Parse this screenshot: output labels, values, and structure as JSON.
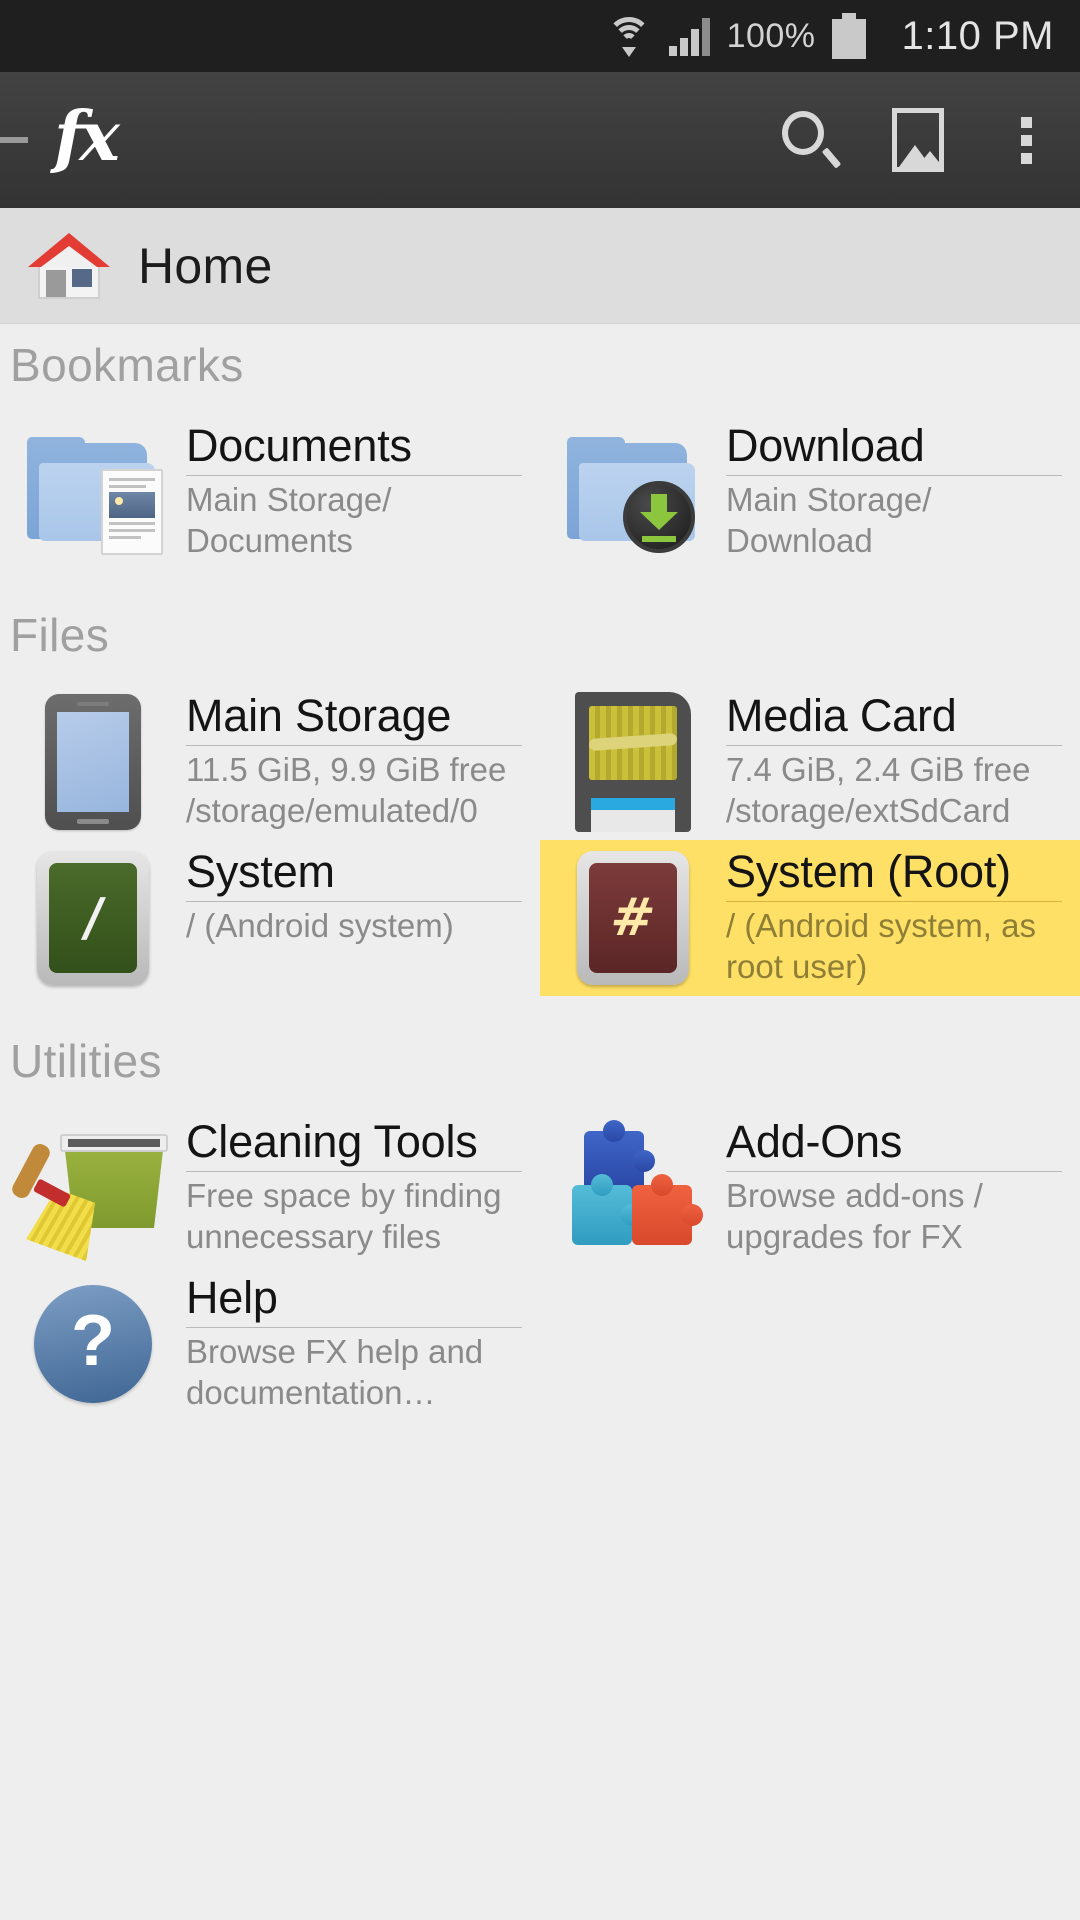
{
  "statusbar": {
    "wifi_icon": "wifi-icon",
    "signal_icon": "signal-bars-icon",
    "battery_percent": "100%",
    "battery_icon": "battery-full-icon",
    "time": "1:10 PM"
  },
  "appbar": {
    "drawer_indicator": "drawer-dash-icon",
    "logo": "fx",
    "search_icon": "search-icon",
    "gallery_icon": "gallery-icon",
    "overflow_icon": "overflow-menu-icon"
  },
  "breadcrumb": {
    "home_icon": "home-icon",
    "label": "Home"
  },
  "sections": [
    {
      "title": "Bookmarks",
      "items": [
        {
          "icon": "folder-documents-icon",
          "title": "Documents",
          "sub": "Main Storage/ Documents",
          "highlighted": false
        },
        {
          "icon": "folder-download-icon",
          "title": "Download",
          "sub": "Main Storage/ Download",
          "highlighted": false
        }
      ]
    },
    {
      "title": "Files",
      "items": [
        {
          "icon": "phone-icon",
          "title": "Main Storage",
          "sub": "11.5 GiB, 9.9 GiB free /storage/emulated/0",
          "highlighted": false
        },
        {
          "icon": "sd-card-icon",
          "title": "Media Card",
          "sub": "7.4 GiB, 2.4 GiB free /storage/extSdCard",
          "highlighted": false
        },
        {
          "icon": "terminal-green-icon",
          "title": "System",
          "sub": "/ (Android system)",
          "highlighted": false
        },
        {
          "icon": "terminal-root-icon",
          "title": "System (Root)",
          "sub": "/ (Android system, as root user)",
          "highlighted": true
        }
      ]
    },
    {
      "title": "Utilities",
      "items": [
        {
          "icon": "cleaning-tools-icon",
          "title": "Cleaning Tools",
          "sub": "Free space by finding unnecessary files",
          "highlighted": false
        },
        {
          "icon": "puzzle-addons-icon",
          "title": "Add-Ons",
          "sub": "Browse add-ons / upgrades for FX",
          "highlighted": false
        },
        {
          "icon": "help-icon",
          "title": "Help",
          "sub": "Browse FX help and documentation…",
          "highlighted": false
        }
      ]
    }
  ],
  "colors": {
    "statusbar_bg": "#1f1f1f",
    "appbar_bg": "#3a3a3a",
    "breadcrumb_bg": "#dddddd",
    "content_bg": "#eeeeee",
    "highlight": "#ffe066",
    "title_text": "#141414",
    "sub_text": "#8a8a8a",
    "section_text": "#a0a0a0"
  },
  "subtitle_lines": {
    "documents": [
      "Main Storage/",
      "Documents"
    ],
    "download": [
      "Main Storage/",
      "Download"
    ],
    "main_storage": [
      "11.5 GiB, 9.9 GiB free",
      "/storage/emulated/0"
    ],
    "media_card": [
      "7.4 GiB, 2.4 GiB free",
      "/storage/extSdCard"
    ],
    "system": [
      "/ (Android system)",
      ""
    ],
    "system_root": [
      "/ (Android system, as",
      "root user)"
    ],
    "cleaning": [
      "Free space by finding",
      "unnecessary files"
    ],
    "addons": [
      "Browse add-ons /",
      "upgrades for FX"
    ],
    "help": [
      "Browse FX help and",
      "documentation…"
    ]
  }
}
